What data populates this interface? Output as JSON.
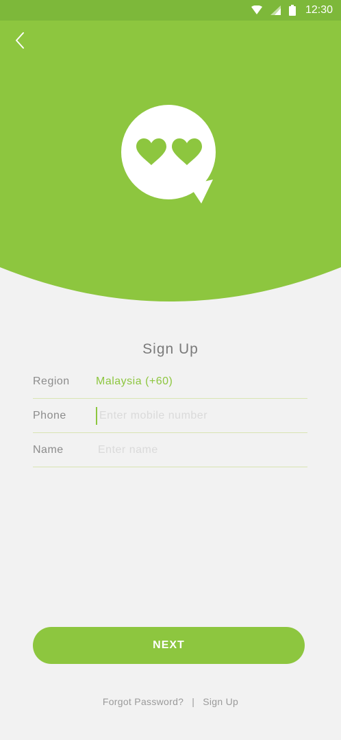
{
  "status_bar": {
    "time": "12:30",
    "icons": [
      "wifi-icon",
      "signal-icon",
      "battery-icon"
    ]
  },
  "header": {
    "back_icon": "chevron-left-icon",
    "logo_icon": "chat-bubble-hearts-icon"
  },
  "form": {
    "title": "Sign Up",
    "region": {
      "label": "Region",
      "value": "Malaysia (+60)"
    },
    "phone": {
      "label": "Phone",
      "value": "",
      "placeholder": "Enter mobile number"
    },
    "name": {
      "label": "Name",
      "value": "",
      "placeholder": "Enter name"
    }
  },
  "actions": {
    "next_label": "NEXT",
    "forgot_password": "Forgot Password?",
    "separator": "|",
    "sign_up": "Sign Up"
  },
  "colors": {
    "primary": "#8dc63f",
    "status_bar": "#7db83a",
    "background": "#f2f2f2"
  }
}
